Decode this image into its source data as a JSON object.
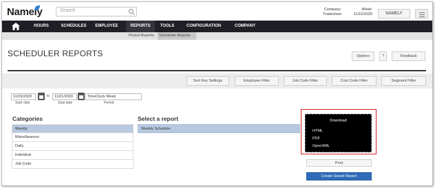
{
  "header": {
    "logo": "Namely",
    "search_placeholder": "Search",
    "company_label": "Company:",
    "company_value": "Tradeshow",
    "week_label": "Week:",
    "week_value": "11/15/2020",
    "account_button": "NAMELY"
  },
  "nav": {
    "items": [
      {
        "label": "HOURS"
      },
      {
        "label": "SCHEDULES"
      },
      {
        "label": "EMPLOYEE"
      },
      {
        "label": "REPORTS"
      },
      {
        "label": "TOOLS"
      },
      {
        "label": "CONFIGURATION"
      },
      {
        "label": "COMPANY"
      }
    ],
    "active": "REPORTS"
  },
  "subnav": {
    "items": [
      {
        "label": "Period Reports"
      },
      {
        "label": "Scheduler Reports"
      }
    ],
    "active": "Scheduler Reports"
  },
  "page": {
    "title": "SCHEDULER REPORTS",
    "options_button": "Options",
    "help_button": "?",
    "feedback_button": "Feedback"
  },
  "filters": {
    "buttons": [
      "Sort Key Settings",
      "Employee Filter",
      "Job Code Filter",
      "Cost Code Filter",
      "Segment Filter"
    ]
  },
  "dates": {
    "start_value": "11/15/2020",
    "start_label": "Start date",
    "to_label": "to",
    "stop_value": "11/21/2020",
    "stop_label": "Stop date",
    "period_value": "TimeClock Week",
    "period_label": "Period"
  },
  "categories": {
    "title": "Categories",
    "items": [
      "Weekly",
      "Miscellaneous",
      "Daily",
      "Individual",
      "Job Code"
    ],
    "selected": "Weekly"
  },
  "reports": {
    "title": "Select a report",
    "items": [
      "Weekly Schedule"
    ],
    "selected": "Weekly Schedule"
  },
  "download": {
    "title": "Download",
    "options": [
      "HTML",
      "PDF",
      "OpenXML"
    ]
  },
  "actions": {
    "print_button": "Print",
    "create_saved_button": "Create Saved Report"
  },
  "colors": {
    "nav_bg": "#1f1f25",
    "selected_row": "#b6c9e0",
    "primary_button": "#2f6cb8",
    "highlight_box": "#d11f1f"
  }
}
